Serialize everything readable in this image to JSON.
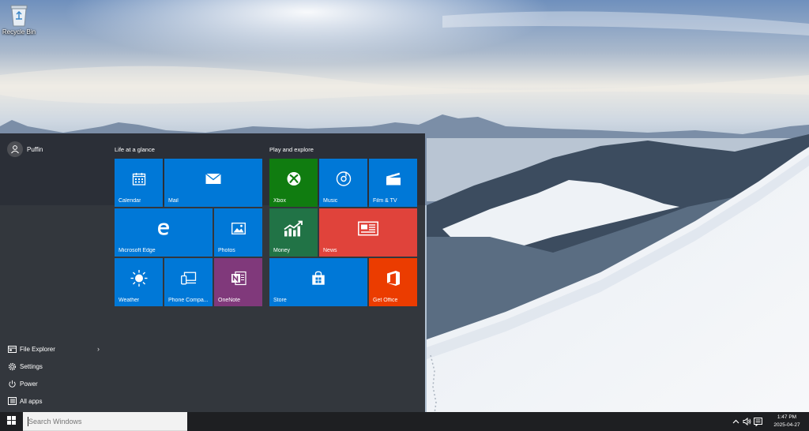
{
  "desktop": {
    "icons": [
      {
        "label": "Recycle Bin",
        "icon": "recycle-bin-icon"
      }
    ]
  },
  "start_menu": {
    "user": {
      "name": "Puffin",
      "icon": "user-avatar-icon"
    },
    "left_items": [
      {
        "label": "File Explorer",
        "icon": "folder-icon",
        "has_arrow": true
      },
      {
        "label": "Settings",
        "icon": "gear-icon"
      },
      {
        "label": "Power",
        "icon": "power-icon"
      },
      {
        "label": "All apps",
        "icon": "list-icon"
      }
    ],
    "groups": [
      {
        "title": "Life at a glance",
        "tiles": [
          {
            "label": "Calendar",
            "icon": "calendar-icon",
            "color": "#0078d7"
          },
          {
            "label": "Mail",
            "icon": "mail-icon",
            "color": "#0078d7"
          },
          {
            "label": "Microsoft Edge",
            "icon": "edge-icon",
            "color": "#0078d7"
          },
          {
            "label": "Photos",
            "icon": "photos-icon",
            "color": "#0078d7"
          },
          {
            "label": "Weather",
            "icon": "weather-sun-icon",
            "color": "#0078d7"
          },
          {
            "label": "Phone Compa...",
            "icon": "phone-companion-icon",
            "color": "#0078d7"
          },
          {
            "label": "OneNote",
            "icon": "onenote-icon",
            "color": "#80397b"
          }
        ]
      },
      {
        "title": "Play and explore",
        "tiles": [
          {
            "label": "Xbox",
            "icon": "xbox-icon",
            "color": "#107c10"
          },
          {
            "label": "Music",
            "icon": "music-icon",
            "color": "#0078d7"
          },
          {
            "label": "Film & TV",
            "icon": "film-icon",
            "color": "#0078d7"
          },
          {
            "label": "Money",
            "icon": "money-chart-icon",
            "color": "#217346"
          },
          {
            "label": "News",
            "icon": "news-icon",
            "color": "#e0433b"
          },
          {
            "label": "Store",
            "icon": "store-bag-icon",
            "color": "#0078d7"
          },
          {
            "label": "Get Office",
            "icon": "office-icon",
            "color": "#eb3c00"
          }
        ]
      }
    ]
  },
  "taskbar": {
    "start_icon": "windows-logo-icon",
    "search": {
      "placeholder": "Search Windows"
    },
    "tray": {
      "icons": [
        "chevron-up-icon",
        "volume-icon",
        "notification-icon"
      ],
      "time": "1:47 PM",
      "date": "2025-04-27"
    }
  }
}
